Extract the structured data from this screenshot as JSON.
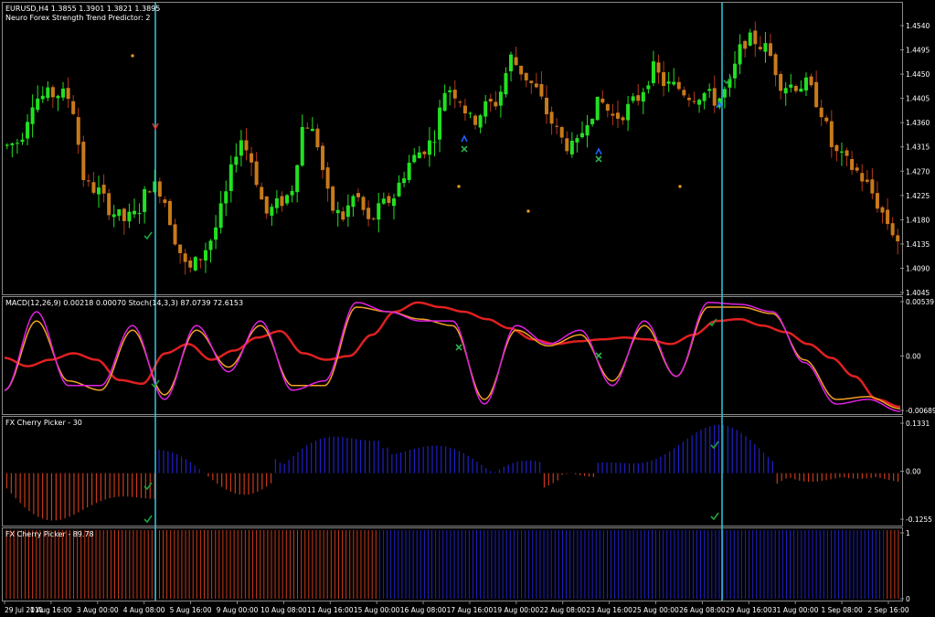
{
  "colors": {
    "background": "#000000",
    "frame": "#8a8a8a",
    "bull": "#22e022",
    "bear": "#c87a1a",
    "bear_wick": "#b33a1a",
    "vline": "#33c8e0",
    "macd_line": "#e02020",
    "stoch_main": "#e020e0",
    "stoch_signal": "#f0a020",
    "hist_pos": "#2020c8",
    "hist_neg": "#c83a1a",
    "marker_check": "#20a040",
    "marker_x": "#30b050",
    "marker_arrow_up": "#2060ff",
    "marker_arrow_down": "#e03030",
    "dot": "#f0a020"
  },
  "panels": {
    "main": {
      "title": "EURUSD,H4  1.3855 1.3901 1.3821 1.3895",
      "subtitle": "Neuro Forex Strength Trend Predictor: 2",
      "y_ticks": [
        "1.4540",
        "1.4495",
        "1.4450",
        "1.4405",
        "1.4360",
        "1.4315",
        "1.4270",
        "1.4225",
        "1.4180",
        "1.4135",
        "1.4090",
        "1.4045"
      ]
    },
    "macd": {
      "title": "MACD(12,26,9) 0.00218 0.00070  Stoch(14,3,3) 87.0739 72.6153",
      "y_ticks": [
        "0.00539",
        "0.00",
        "-0.00689"
      ]
    },
    "cherry1": {
      "title": "FX Cherry Picker - 30",
      "y_ticks": [
        "0.1331",
        "0.00",
        "-0.1255"
      ]
    },
    "cherry2": {
      "title": "FX Cherry Picker - 89.78",
      "y_ticks": [
        "1",
        "0"
      ]
    }
  },
  "x_ticks": [
    "29 Jul 2011",
    "1 Aug 16:00",
    "3 Aug 00:00",
    "4 Aug 08:00",
    "5 Aug 16:00",
    "9 Aug 00:00",
    "10 Aug 08:00",
    "11 Aug 16:00",
    "15 Aug 00:00",
    "16 Aug 08:00",
    "17 Aug 16:00",
    "19 Aug 00:00",
    "22 Aug 08:00",
    "23 Aug 16:00",
    "25 Aug 00:00",
    "26 Aug 08:00",
    "29 Aug 16:00",
    "31 Aug 00:00",
    "1 Sep 08:00",
    "2 Sep 16:00"
  ],
  "chart_data": {
    "type": "line",
    "symbol": "EURUSD,H4",
    "ohlc_last": {
      "open": 1.3855,
      "high": 1.3901,
      "low": 1.3821,
      "close": 1.3895
    },
    "price_range": [
      1.4045,
      1.456
    ],
    "close_path": [
      1.431,
      1.432,
      1.4395,
      1.44,
      1.4405,
      1.4395,
      1.424,
      1.423,
      1.4195,
      1.4175,
      1.4185,
      1.424,
      1.423,
      1.4145,
      1.408,
      1.411,
      1.415,
      1.4225,
      1.433,
      1.428,
      1.4185,
      1.4205,
      1.4225,
      1.436,
      1.432,
      1.42,
      1.418,
      1.4225,
      1.417,
      1.42,
      1.422,
      1.4275,
      1.43,
      1.432,
      1.442,
      1.44,
      1.435,
      1.438,
      1.439,
      1.447,
      1.444,
      1.441,
      1.436,
      1.432,
      1.43,
      1.4365,
      1.439,
      1.436,
      1.4375,
      1.44,
      1.445,
      1.442,
      1.4415,
      1.44,
      1.4405,
      1.439,
      1.442,
      1.45,
      1.45,
      1.448,
      1.442,
      1.442,
      1.442,
      1.438,
      1.43,
      1.428,
      1.426,
      1.4225,
      1.418,
      1.414
    ],
    "macd_range": [
      -0.00689,
      0.00539
    ],
    "macd_signal": [
      -0.001,
      -0.0019,
      -0.0012,
      -0.0005,
      -0.0012,
      -0.0034,
      -0.0038,
      -0.0005,
      0.0005,
      -0.0012,
      -0.0002,
      0.0012,
      0.0019,
      -0.0005,
      -0.0012,
      -0.0008,
      0.0015,
      0.004,
      0.005,
      0.0045,
      0.004,
      0.0032,
      0.0022,
      0.001,
      0.0005,
      0.0008,
      0.001,
      0.0012,
      0.001,
      0.0005,
      0.0015,
      0.003,
      0.0032,
      0.0025,
      0.0018,
      0.0005,
      -0.001,
      -0.003,
      -0.0055,
      -0.0063
    ],
    "stoch_main": [
      -0.0045,
      0.004,
      -0.004,
      -0.004,
      0.0025,
      -0.0055,
      0.0025,
      -0.0025,
      0.003,
      -0.0045,
      -0.0035,
      0.005,
      0.004,
      0.003,
      0.003,
      -0.006,
      0.0025,
      0.0005,
      0.002,
      -0.004,
      0.003,
      -0.003,
      0.005,
      0.0048,
      0.004,
      -0.0015,
      -0.006,
      -0.0055,
      -0.0068
    ],
    "stoch_signal": [
      -0.0045,
      0.003,
      -0.0035,
      -0.0045,
      0.002,
      -0.005,
      0.002,
      -0.002,
      0.0025,
      -0.004,
      -0.004,
      0.0045,
      0.004,
      0.0032,
      0.0025,
      -0.0055,
      0.002,
      0.0003,
      0.0015,
      -0.0035,
      0.0025,
      -0.003,
      0.0045,
      0.0045,
      0.0038,
      -0.0012,
      -0.0055,
      -0.0052,
      -0.0065
    ],
    "cherry_range": [
      -0.1255,
      0.1331
    ]
  }
}
